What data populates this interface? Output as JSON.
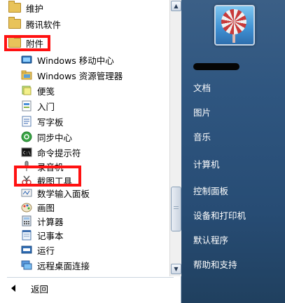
{
  "start_menu": {
    "programs": [
      {
        "label": "维护",
        "icon": "folder-icon",
        "type": "folder"
      },
      {
        "label": "腾讯软件",
        "icon": "folder-icon",
        "type": "folder"
      },
      {
        "label": "附件",
        "icon": "folder-icon",
        "type": "folder",
        "highlighted": true
      },
      {
        "label": "Windows 移动中心",
        "icon": "mobility-center-icon"
      },
      {
        "label": "Windows 资源管理器",
        "icon": "explorer-icon"
      },
      {
        "label": "便笺",
        "icon": "sticky-notes-icon"
      },
      {
        "label": "入门",
        "icon": "getting-started-icon"
      },
      {
        "label": "写字板",
        "icon": "wordpad-icon"
      },
      {
        "label": "同步中心",
        "icon": "sync-center-icon"
      },
      {
        "label": "命令提示符",
        "icon": "cmd-icon"
      },
      {
        "label": "录音机",
        "icon": "sound-recorder-icon"
      },
      {
        "label": "截图工具",
        "icon": "snipping-tool-icon",
        "highlighted": true
      },
      {
        "label": "数学输入面板",
        "icon": "math-input-icon"
      },
      {
        "label": "画图",
        "icon": "paint-icon"
      },
      {
        "label": "计算器",
        "icon": "calculator-icon"
      },
      {
        "label": "记事本",
        "icon": "notepad-icon"
      },
      {
        "label": "运行",
        "icon": "run-icon"
      },
      {
        "label": "远程桌面连接",
        "icon": "remote-desktop-icon"
      }
    ],
    "back_label": "返回",
    "right_links": [
      {
        "label": "文档"
      },
      {
        "label": "图片"
      },
      {
        "label": "音乐"
      },
      {
        "label": "计算机"
      },
      {
        "label": "控制面板"
      },
      {
        "label": "设备和打印机"
      },
      {
        "label": "默认程序"
      },
      {
        "label": "帮助和支持"
      }
    ],
    "highlight_color": "#ff1111"
  }
}
